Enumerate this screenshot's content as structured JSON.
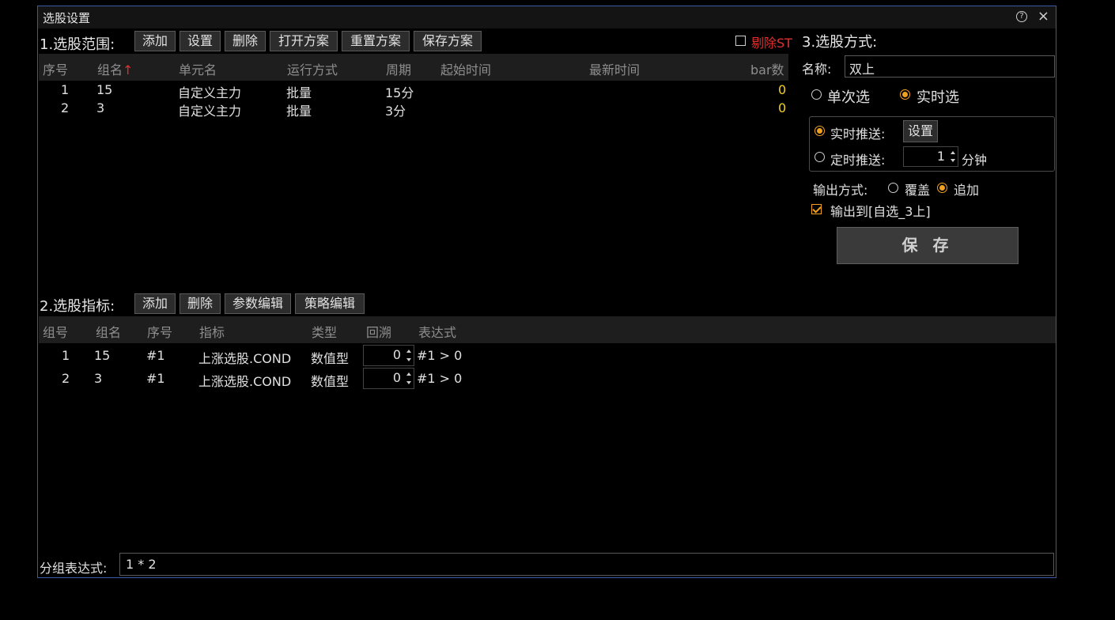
{
  "window": {
    "title": "选股设置",
    "help_icon": "?",
    "close_icon": "×"
  },
  "scope": {
    "label": "1.选股范围:",
    "buttons": [
      "添加",
      "设置",
      "删除",
      "打开方案",
      "重置方案",
      "保存方案"
    ],
    "exclude_st": {
      "label": "剔除ST",
      "checked": false,
      "color": "#e03030"
    },
    "columns": [
      "序号",
      "组名",
      "单元名",
      "运行方式",
      "周期",
      "起始时间",
      "最新时间",
      "bar数"
    ],
    "sort_arrow": "↑",
    "rows": [
      {
        "idx": "1",
        "group": "15",
        "unit": "自定义主力",
        "mode": "批量",
        "period": "15分",
        "start": "",
        "latest": "",
        "bars": "0"
      },
      {
        "idx": "2",
        "group": "3",
        "unit": "自定义主力",
        "mode": "批量",
        "period": "3分",
        "start": "",
        "latest": "",
        "bars": "0"
      }
    ]
  },
  "indicators": {
    "label": "2.选股指标:",
    "buttons": [
      "添加",
      "删除",
      "参数编辑",
      "策略编辑"
    ],
    "columns": [
      "组号",
      "组名",
      "序号",
      "指标",
      "类型",
      "回溯",
      "表达式"
    ],
    "rows": [
      {
        "gid": "1",
        "group": "15",
        "seq": "#1",
        "indicator": "上涨选股.COND",
        "type": "数值型",
        "lookback": "0",
        "expr": "#1 > 0"
      },
      {
        "gid": "2",
        "group": "3",
        "seq": "#1",
        "indicator": "上涨选股.COND",
        "type": "数值型",
        "lookback": "0",
        "expr": "#1 > 0"
      }
    ]
  },
  "group_expr": {
    "label": "分组表达式:",
    "value": "1 * 2"
  },
  "method": {
    "label": "3.选股方式:",
    "name_label": "名称:",
    "name_value": "双上",
    "single_label": "单次选",
    "realtime_label": "实时选",
    "selected": "realtime",
    "push_realtime_label": "实时推送:",
    "push_realtime_btn": "设置",
    "push_timed_label": "定时推送:",
    "push_timed_value": "1",
    "push_timed_unit": "分钟",
    "push_selected": "realtime",
    "output_label": "输出方式:",
    "output_cover": "覆盖",
    "output_append": "追加",
    "output_selected": "append",
    "output_to_label": "输出到[自选_3上]",
    "output_to_checked": true,
    "save_label": "保 存",
    "accent_color": "#f0a020"
  }
}
